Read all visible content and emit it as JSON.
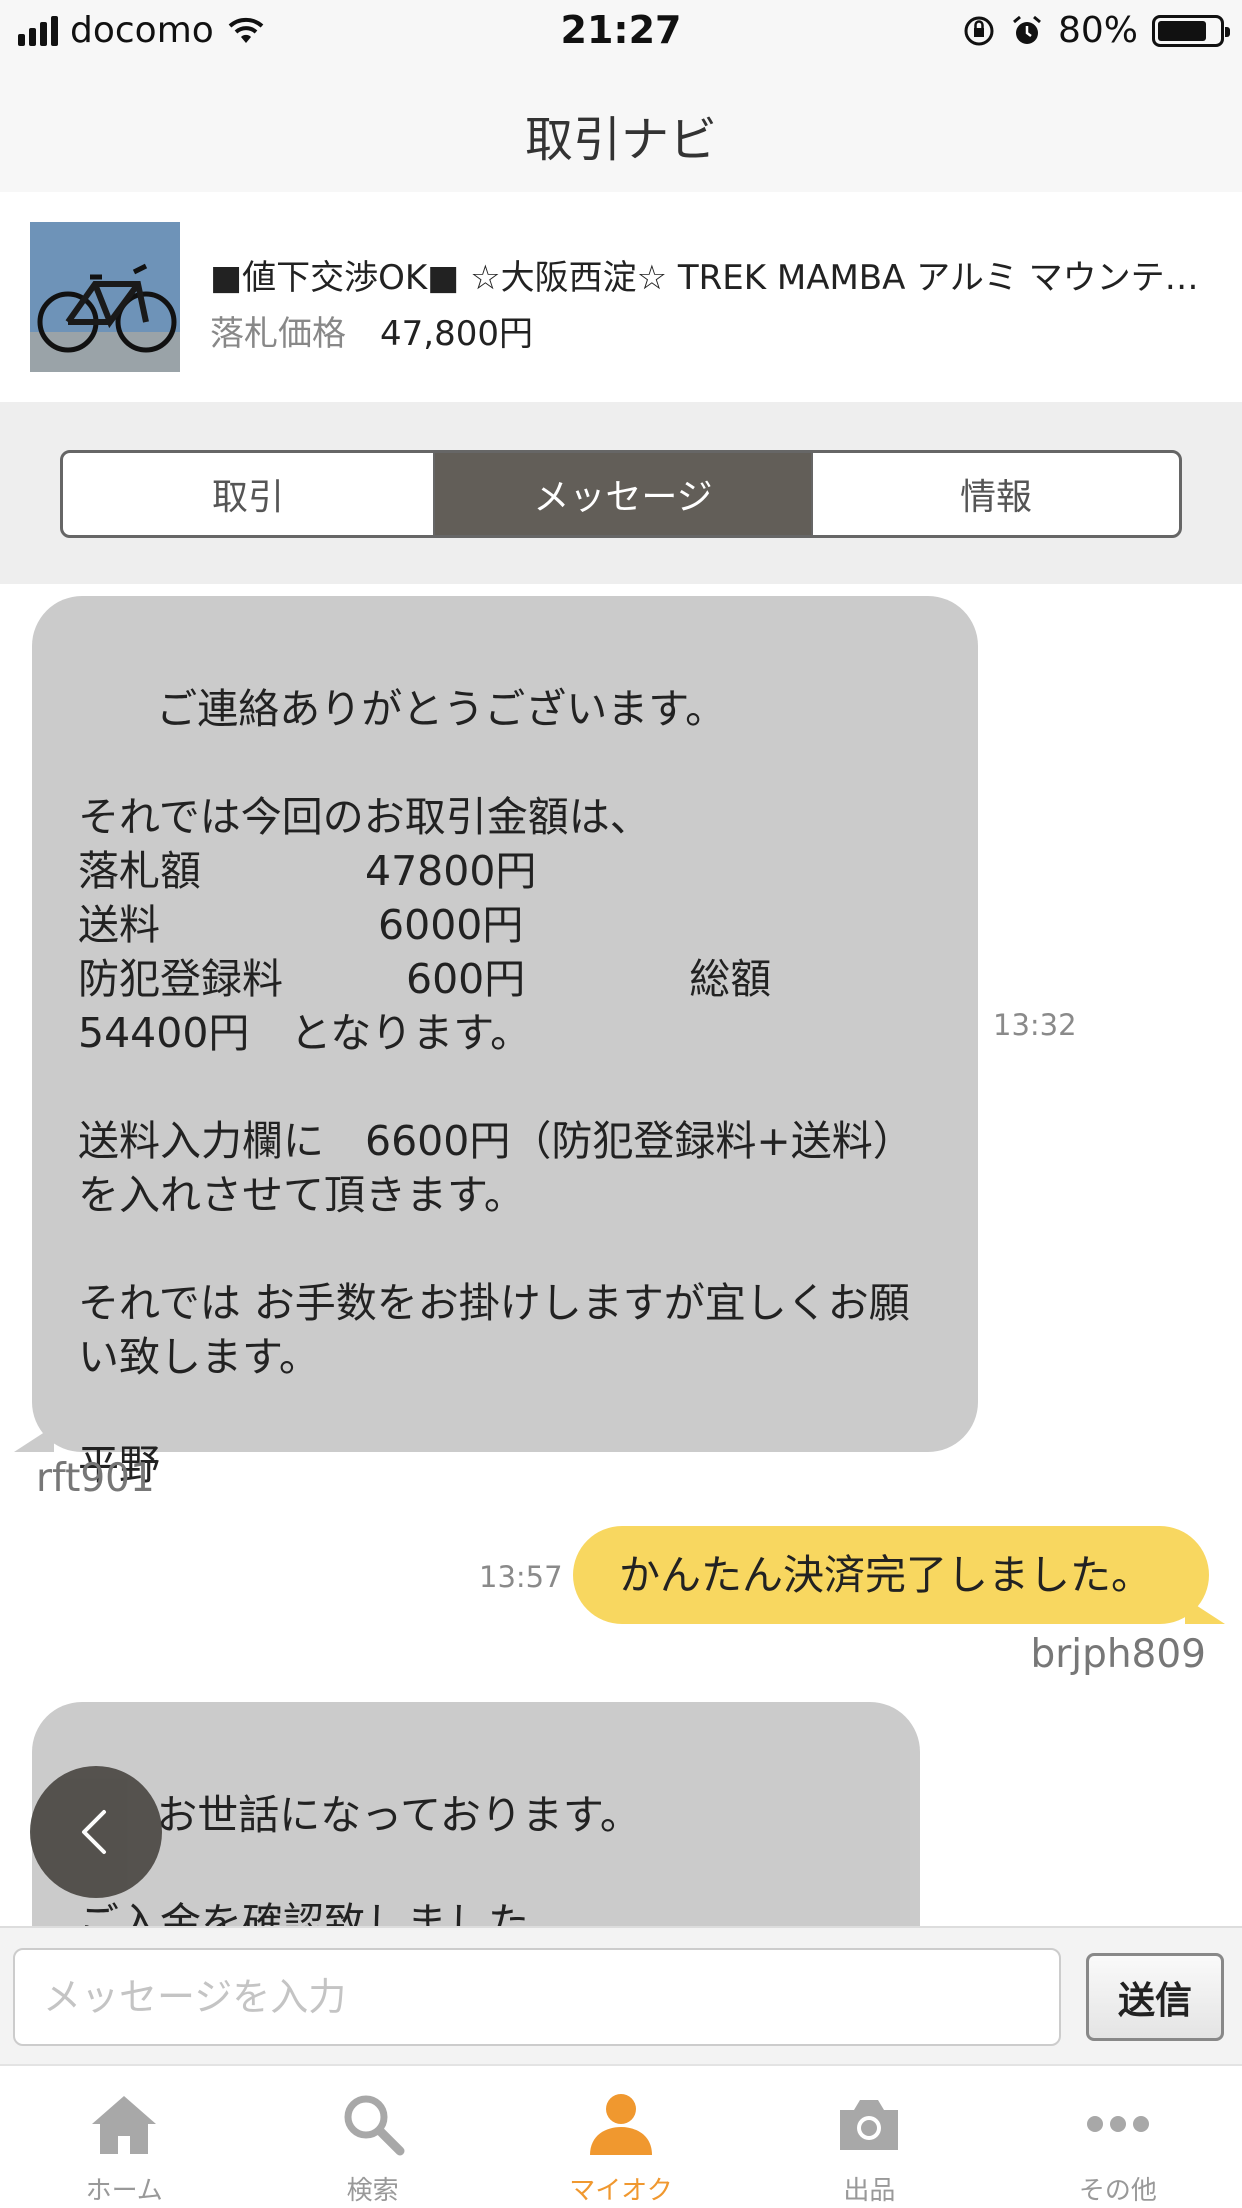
{
  "status_bar": {
    "carrier": "docomo",
    "time": "21:27",
    "battery": "80%",
    "battery_level": 0.8
  },
  "nav": {
    "title": "取引ナビ"
  },
  "product": {
    "title": "■値下交渉OK■ ☆大阪西淀☆ TREK MAMBA アルミ マウンテンバイク",
    "price_label": "落札価格",
    "price": "47,800円"
  },
  "segments": [
    {
      "label": "取引",
      "selected": false
    },
    {
      "label": "メッセージ",
      "selected": true
    },
    {
      "label": "情報",
      "selected": false
    }
  ],
  "messages": [
    {
      "direction": "in",
      "text": "ご連絡ありがとうございます。\n\nそれでは今回のお取引金額は、\n落札額　　　　47800円\n送料　　　　　 6000円\n防犯登録料　　　600円　　　　総額\n54400円　となります。\n\n送料入力欄に　6600円（防犯登録料+送料）\nを入れさせて頂きます。\n\nそれでは お手数をお掛けしますが宜しくお願\nい致します。\n\n平野",
      "time": "13:32",
      "sender": "rft901"
    },
    {
      "direction": "out",
      "text": "かんたん決済完了しました。",
      "time": "13:57",
      "sender": "brjph809"
    },
    {
      "direction": "in",
      "text": "お世話になっております。\n\nご入金を確認致しました。\nありがとうございます。",
      "time": "",
      "sender": ""
    }
  ],
  "input": {
    "placeholder": "メッセージを入力",
    "value": ""
  },
  "send_label": "送信",
  "tabs": [
    {
      "label": "ホーム",
      "icon": "home-icon",
      "active": false
    },
    {
      "label": "検索",
      "icon": "search-icon",
      "active": false
    },
    {
      "label": "マイオク",
      "icon": "person-icon",
      "active": true
    },
    {
      "label": "出品",
      "icon": "camera-icon",
      "active": false
    },
    {
      "label": "その他",
      "icon": "more-icon",
      "active": false
    }
  ],
  "colors": {
    "accent": "#f0982f",
    "outgoing_bubble": "#f8d760",
    "incoming_bubble": "#cbcbcb",
    "segment_selected": "#625e58"
  }
}
